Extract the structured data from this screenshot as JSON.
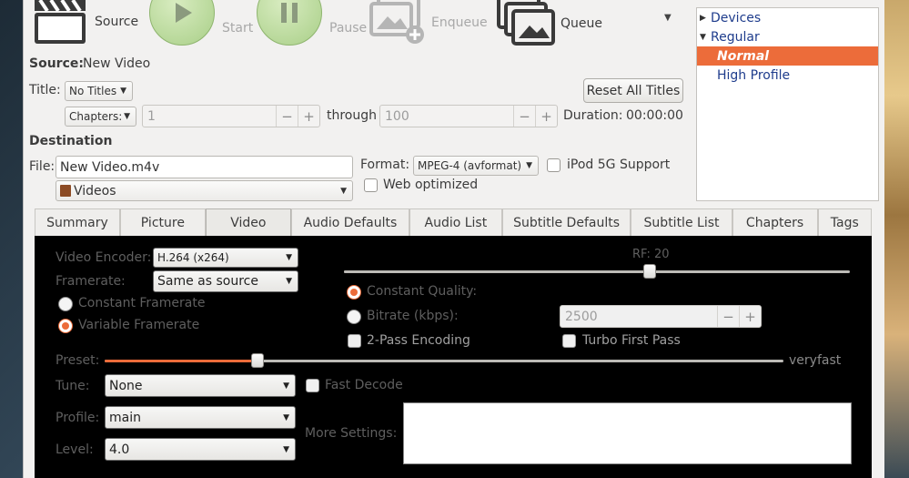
{
  "toolbar": {
    "source_label": "Source",
    "start_label": "Start",
    "pause_label": "Pause",
    "enqueue_label": "Enqueue",
    "queue_label": "Queue"
  },
  "source": {
    "label": "Source:",
    "value": "New Video",
    "title_label": "Title:",
    "title_value": "No Titles",
    "chapters_value": "Chapters:",
    "from_value": "1",
    "through_label": "through",
    "to_value": "100",
    "duration_label": "Duration:",
    "duration_value": "00:00:00",
    "reset_button": "Reset All Titles"
  },
  "destination": {
    "heading": "Destination",
    "file_label": "File:",
    "file_value": "New Video.m4v",
    "folder_value": "Videos",
    "format_label": "Format:",
    "format_value": "MPEG-4 (avformat)",
    "ipod_label": "iPod 5G Support",
    "web_label": "Web optimized"
  },
  "presets": {
    "groups": [
      {
        "label": "Devices",
        "expanded": false
      },
      {
        "label": "Regular",
        "expanded": true
      }
    ],
    "items": [
      "Normal",
      "High Profile"
    ],
    "selected": "Normal"
  },
  "tabs": [
    "Summary",
    "Picture",
    "Video",
    "Audio Defaults",
    "Audio List",
    "Subtitle Defaults",
    "Subtitle List",
    "Chapters",
    "Tags"
  ],
  "active_tab": "Video",
  "video": {
    "encoder_label": "Video Encoder:",
    "encoder_value": "H.264 (x264)",
    "framerate_label": "Framerate:",
    "framerate_value": "Same as source",
    "constant_fr_label": "Constant Framerate",
    "variable_fr_label": "Variable Framerate",
    "rf_label": "RF: 20",
    "rf_fraction": 0.605,
    "constant_quality_label": "Constant Quality:",
    "bitrate_label": "Bitrate (kbps):",
    "bitrate_value": "2500",
    "two_pass_label": "2-Pass Encoding",
    "turbo_label": "Turbo First Pass",
    "preset_label": "Preset:",
    "preset_value": "veryfast",
    "preset_fraction": 0.225,
    "tune_label": "Tune:",
    "tune_value": "None",
    "fast_decode_label": "Fast Decode",
    "profile_label": "Profile:",
    "profile_value": "main",
    "level_label": "Level:",
    "level_value": "4.0",
    "more_settings_label": "More Settings:"
  },
  "colors": {
    "accent": "#ec6c3a",
    "link": "#1e3c8c"
  }
}
